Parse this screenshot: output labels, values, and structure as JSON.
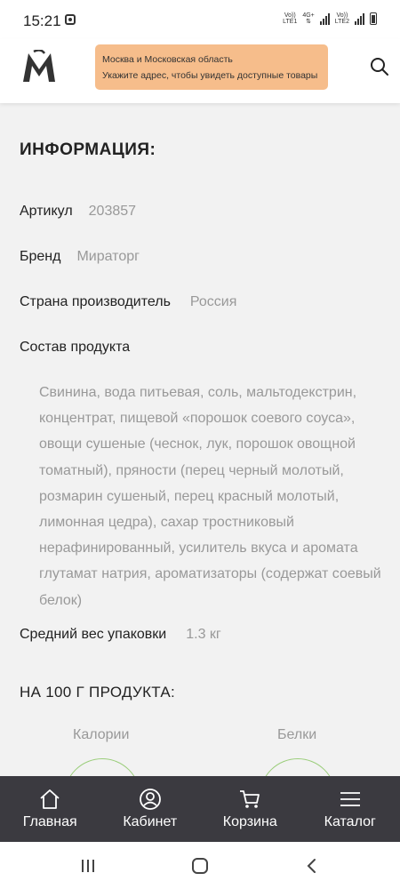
{
  "status_bar": {
    "time": "15:21",
    "sim1_top": "Vo))",
    "sim1_bottom": "LTE1",
    "net_type": "4G+",
    "sim2_top": "Vo))",
    "sim2_bottom": "LTE2"
  },
  "header": {
    "logo_icon": "miratorg-m-logo",
    "banner_line1": "Москва и Московская область",
    "banner_line2": "Укажите адрес, чтобы увидеть доступные товары",
    "banner_color": "#f6bd8b",
    "search_icon": "search-icon"
  },
  "info": {
    "title": "ИНФОРМАЦИЯ:",
    "article_label": "Артикул",
    "article_value": "203857",
    "brand_label": "Бренд",
    "brand_value": "Мираторг",
    "country_label": "Страна производитель",
    "country_value": "Россия",
    "composition_label": "Состав продукта",
    "composition_text": "Свинина, вода питьевая, соль, мальтодекстрин, концентрат, пищевой «порошок соевого соуса», овощи сушеные (чеснок, лук, порошок овощной томатный), пряности (перец черный молотый, розмарин сушеный, перец красный молотый, лимонная цедра), сахар тростниковый нерафинированный, усилитель вкуса и аромата глутамат натрия, ароматизаторы (содержат соевый белок)",
    "weight_label": "Средний вес упаковки",
    "weight_value": "1.3 кг"
  },
  "nutrition": {
    "title": "НА 100 Г ПРОДУКТА:",
    "calories_label": "Калории",
    "protein_label": "Белки",
    "ring_color": "#9acd7a"
  },
  "bottom_nav": {
    "background": "#3b3a40",
    "items": [
      {
        "label": "Главная",
        "icon": "home-icon"
      },
      {
        "label": "Кабинет",
        "icon": "user-icon"
      },
      {
        "label": "Корзина",
        "icon": "cart-icon"
      },
      {
        "label": "Каталог",
        "icon": "menu-icon"
      }
    ]
  }
}
